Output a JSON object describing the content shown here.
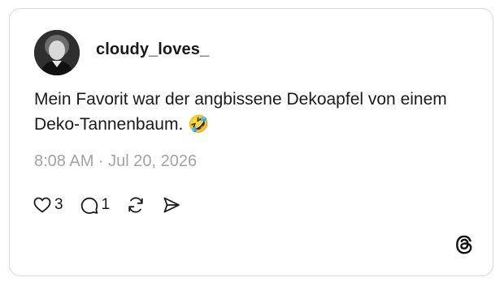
{
  "post": {
    "username": "cloudy_loves_",
    "text": "Mein Favorit war der angbissene Dekoapfel von einem Deko-Tannenbaum. 🤣",
    "timestamp": "8:08 AM · Jul 20, 2026"
  },
  "actions": {
    "likes": "3",
    "replies": "1"
  },
  "icons": {
    "like": "heart-icon",
    "reply": "comment-bubble-icon",
    "repost": "repost-icon",
    "share": "send-icon",
    "brand": "threads-logo-icon"
  },
  "colors": {
    "text": "#1a1a1a",
    "muted": "#a3a3a3",
    "border": "#d9d9d9"
  }
}
